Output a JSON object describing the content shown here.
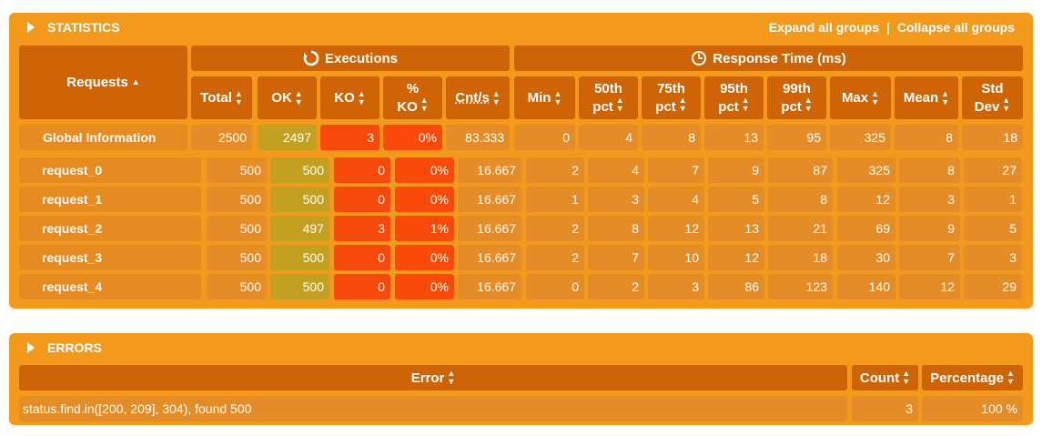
{
  "statistics": {
    "title": "STATISTICS",
    "expand_label": "Expand all groups",
    "separator": "|",
    "collapse_label": "Collapse all groups",
    "headers": {
      "requests": "Requests",
      "executions": "Executions",
      "response_time": "Response Time (ms)",
      "total": "Total",
      "ok": "OK",
      "ko": "KO",
      "pct_ko_1": "%",
      "pct_ko_2": "KO",
      "cnt": "Cnt/s",
      "min": "Min",
      "p50_1": "50th",
      "p50_2": "pct",
      "p75_1": "75th",
      "p75_2": "pct",
      "p95_1": "95th",
      "p95_2": "pct",
      "p99_1": "99th",
      "p99_2": "pct",
      "max": "Max",
      "mean": "Mean",
      "std_1": "Std",
      "std_2": "Dev"
    },
    "rows": [
      {
        "name": "Global Information",
        "total": "2500",
        "ok": "2497",
        "ko": "3",
        "pct": "0%",
        "cnt": "83.333",
        "min": "0",
        "p50": "4",
        "p75": "8",
        "p95": "13",
        "p99": "95",
        "max": "325",
        "mean": "8",
        "std": "18"
      },
      {
        "name": "request_0",
        "total": "500",
        "ok": "500",
        "ko": "0",
        "pct": "0%",
        "cnt": "16.667",
        "min": "2",
        "p50": "4",
        "p75": "7",
        "p95": "9",
        "p99": "87",
        "max": "325",
        "mean": "8",
        "std": "27"
      },
      {
        "name": "request_1",
        "total": "500",
        "ok": "500",
        "ko": "0",
        "pct": "0%",
        "cnt": "16.667",
        "min": "1",
        "p50": "3",
        "p75": "4",
        "p95": "5",
        "p99": "8",
        "max": "12",
        "mean": "3",
        "std": "1"
      },
      {
        "name": "request_2",
        "total": "500",
        "ok": "497",
        "ko": "3",
        "pct": "1%",
        "cnt": "16.667",
        "min": "2",
        "p50": "8",
        "p75": "12",
        "p95": "13",
        "p99": "21",
        "max": "69",
        "mean": "9",
        "std": "5"
      },
      {
        "name": "request_3",
        "total": "500",
        "ok": "500",
        "ko": "0",
        "pct": "0%",
        "cnt": "16.667",
        "min": "2",
        "p50": "7",
        "p75": "10",
        "p95": "12",
        "p99": "18",
        "max": "30",
        "mean": "7",
        "std": "3"
      },
      {
        "name": "request_4",
        "total": "500",
        "ok": "500",
        "ko": "0",
        "pct": "0%",
        "cnt": "16.667",
        "min": "0",
        "p50": "2",
        "p75": "3",
        "p95": "86",
        "p99": "123",
        "max": "140",
        "mean": "12",
        "std": "29"
      }
    ]
  },
  "errors": {
    "title": "ERRORS",
    "headers": {
      "error": "Error",
      "count": "Count",
      "percentage": "Percentage"
    },
    "rows": [
      {
        "error": "status.find.in([200, 209], 304), found 500",
        "count": "3",
        "percentage": "100 %"
      }
    ]
  },
  "colors": {
    "panel": "#f39a1d",
    "header": "#cf6406",
    "ok": "#c4a022",
    "ko": "#f7490b"
  },
  "icons": [
    "expand-triangle-icon",
    "sort-icon",
    "executions-icon",
    "clock-icon"
  ]
}
